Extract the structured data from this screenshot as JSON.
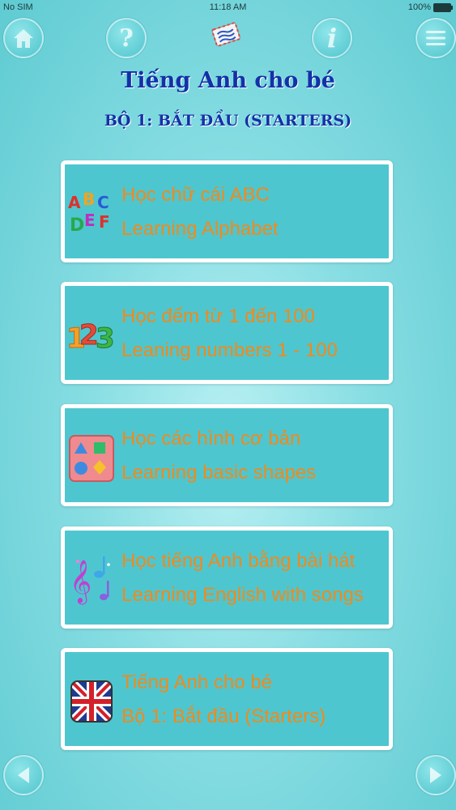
{
  "status_bar": {
    "carrier": "No SIM",
    "time": "11:18 AM",
    "battery": "100%"
  },
  "header": {
    "title": "Tiếng Anh cho bé",
    "subtitle": "BỘ 1: BẮT ĐẦU (STARTERS)",
    "help_glyph": "?",
    "info_glyph": "i"
  },
  "menu": [
    {
      "line1": "Học chữ cái ABC",
      "line2": "Learning Alphabet",
      "icon": "alphabet-icon"
    },
    {
      "line1": "Học đếm từ 1 đến 100",
      "line2": "Leaning numbers 1 - 100",
      "icon": "numbers-icon"
    },
    {
      "line1": "Học các hình cơ bản",
      "line2": "Learning basic shapes",
      "icon": "shapes-icon"
    },
    {
      "line1": "Học tiếng Anh bằng bài hát",
      "line2": "Learning English with songs",
      "icon": "music-icon"
    },
    {
      "line1": "Tiếng Anh cho bé",
      "line2": "Bộ 1: Bắt đầu (Starters)",
      "icon": "uk-flag-icon"
    }
  ],
  "icon_letters": {
    "a": "A",
    "b": "B",
    "c": "C",
    "d": "D",
    "e": "E",
    "f": "F",
    "n1": "1",
    "n2": "2",
    "n3": "3"
  },
  "colors": {
    "title": "#1232a8",
    "item_text": "#f08a1d",
    "card_bg": "#4ec6cf"
  }
}
